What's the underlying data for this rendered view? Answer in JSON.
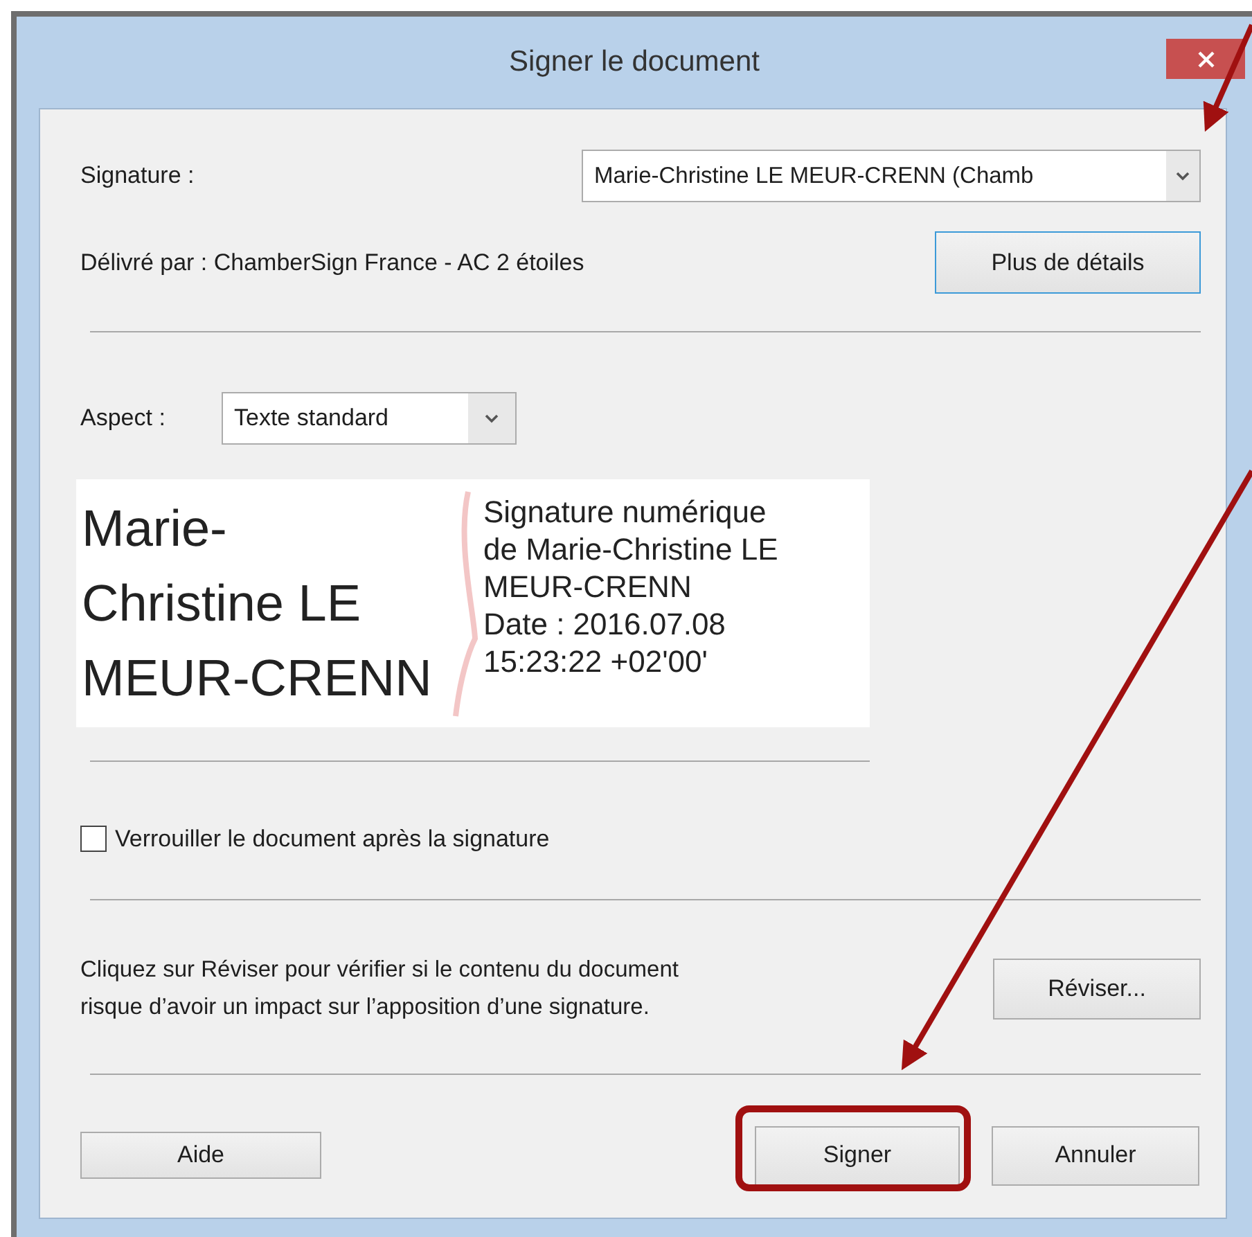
{
  "window": {
    "title": "Signer le document"
  },
  "signature": {
    "label": "Signature :",
    "value": "Marie-Christine LE MEUR-CRENN (Chamb"
  },
  "issuer": {
    "text": "Délivré par : ChamberSign France - AC 2 étoiles",
    "button": "Plus de détails"
  },
  "aspect": {
    "label": "Aspect :",
    "value": "Texte standard"
  },
  "preview": {
    "name_lines": [
      "Marie-",
      "Christine LE",
      "MEUR-CRENN"
    ],
    "detail_lines": [
      "Signature numérique",
      "de Marie-Christine LE",
      "MEUR-CRENN",
      "Date : 2016.07.08",
      "15:23:22 +02'00'"
    ]
  },
  "lock": {
    "label": "Verrouiller le document après la signature",
    "checked": false
  },
  "review": {
    "text": [
      "Cliquez sur Réviser pour vérifier si le contenu du document",
      "risque d’avoir un impact sur l’apposition d’une signature."
    ],
    "button": "Réviser..."
  },
  "buttons": {
    "help": "Aide",
    "sign": "Signer",
    "cancel": "Annuler"
  }
}
